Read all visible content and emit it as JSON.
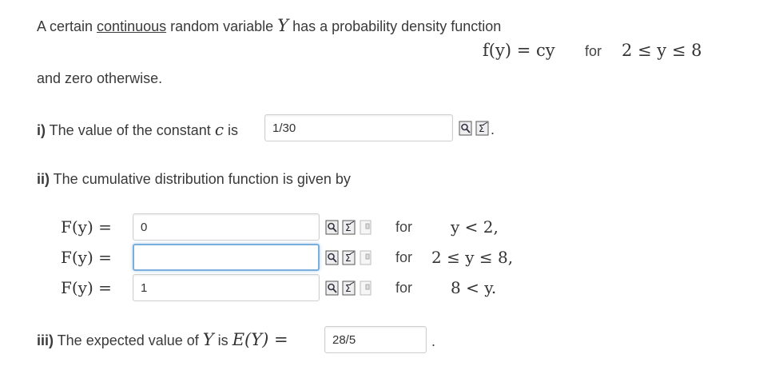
{
  "intro": {
    "text_a": "A certain ",
    "link": "continuous",
    "text_b": " random variable ",
    "var": "Y",
    "text_c": " has a probability density function"
  },
  "pdf": {
    "lhs": "f(y) = cy",
    "for": "for",
    "range": "2 ≤ y ≤ 8"
  },
  "otherwise": "and zero otherwise.",
  "part1": {
    "label": "i)",
    "text": " The value of the constant ",
    "var": "c",
    "is": " is",
    "value": "1/30",
    "end": "."
  },
  "part2": {
    "label": "ii)",
    "text": " The cumulative distribution function is given by",
    "rows": [
      {
        "lhs": "F(y) =",
        "value": "0",
        "for": "for",
        "cond": "y < 2,"
      },
      {
        "lhs": "F(y) =",
        "value": "",
        "for": "for",
        "cond": "2 ≤ y ≤ 8,"
      },
      {
        "lhs": "F(y) =",
        "value": "1",
        "for": "for",
        "cond": "8 < y."
      }
    ]
  },
  "part3": {
    "label": "iii)",
    "text": " The expected value of ",
    "var": "Y",
    "is": " is ",
    "expr": "E(Y) =",
    "value": "28/5",
    "end": "."
  },
  "icons": [
    "preview-icon",
    "equation-editor-icon",
    "clear-icon"
  ]
}
